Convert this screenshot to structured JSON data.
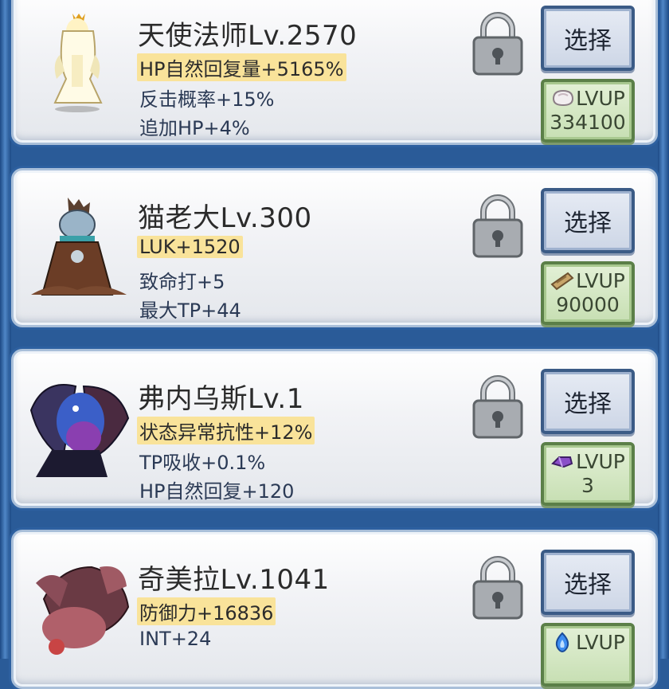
{
  "characters": [
    {
      "name": "天使法师Lv.2570",
      "stat1": "HP自然回复量+5165%",
      "stat2": "反击概率+15%",
      "stat3": "追加HP+4%",
      "select_label": "选择",
      "lvup_label": "LVUP",
      "lvup_cost": "334100",
      "lvup_icon": "stone-icon"
    },
    {
      "name": "猫老大Lv.300",
      "stat1": "LUK+1520",
      "stat2": "致命打+5",
      "stat3": "最大TP+44",
      "select_label": "选择",
      "lvup_label": "LVUP",
      "lvup_cost": "90000",
      "lvup_icon": "wood-icon"
    },
    {
      "name": "弗内乌斯Lv.1",
      "stat1": "状态异常抗性+12%",
      "stat2": "TP吸收+0.1%",
      "stat3": "HP自然回复+120",
      "select_label": "选择",
      "lvup_label": "LVUP",
      "lvup_cost": "3",
      "lvup_icon": "purple-crystal-icon"
    },
    {
      "name": "奇美拉Lv.1041",
      "stat1": "防御力+16836",
      "stat2": "INT+24",
      "stat3": "",
      "select_label": "选择",
      "lvup_label": "LVUP",
      "lvup_cost": "",
      "lvup_icon": "blue-flame-icon"
    }
  ],
  "colors": {
    "frame": "#2a5b98",
    "highlight": "#f9e39a",
    "select_border": "#3b5b86",
    "lvup_border": "#5b7f48"
  }
}
